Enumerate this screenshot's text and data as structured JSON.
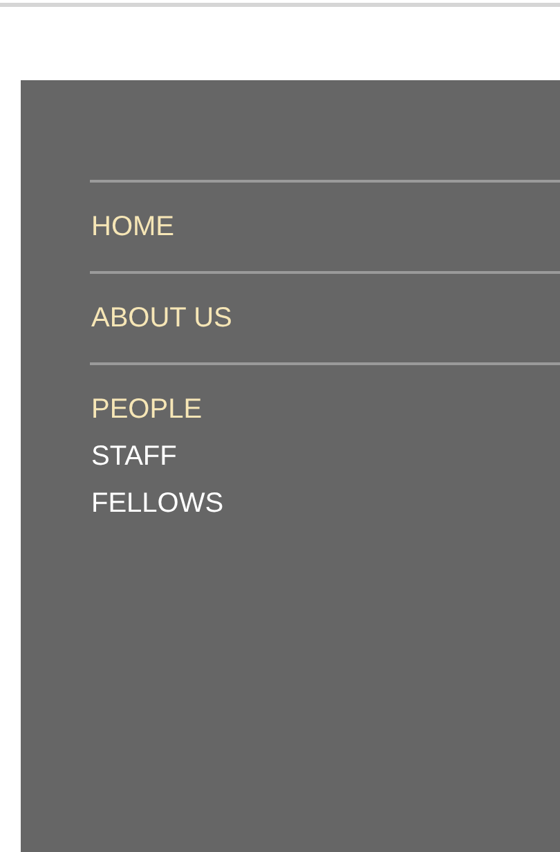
{
  "menu": [
    {
      "label": "HOME"
    },
    {
      "label": "ABOUT US"
    },
    {
      "label": "PEOPLE",
      "children": [
        {
          "label": "STAFF"
        },
        {
          "label": "FELLOWS"
        }
      ]
    }
  ]
}
